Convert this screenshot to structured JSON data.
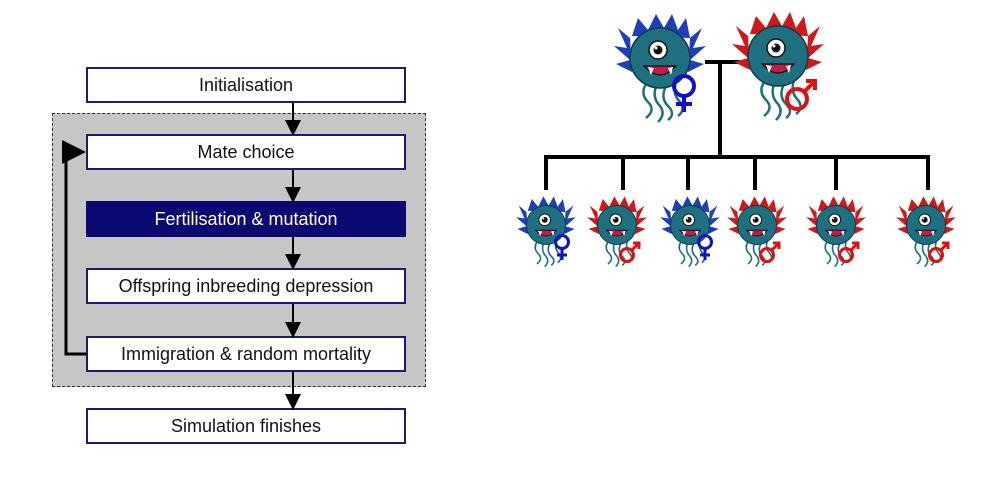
{
  "flowchart": {
    "steps": [
      "Initialisation",
      "Mate choice",
      "Fertilisation & mutation",
      "Offspring inbreeding depression",
      "Immigration & random mortality",
      "Simulation finishes"
    ],
    "highlighted_step": "Fertilisation & mutation"
  },
  "pedigree": {
    "parents": [
      "female",
      "male"
    ],
    "offspring": [
      "female",
      "male",
      "female",
      "male",
      "male",
      "male"
    ]
  },
  "colors": {
    "box_border": "#1a1a7a",
    "highlight": "#0a0a72",
    "loop_panel": "#c6c6c6",
    "female_symbol": "#1010c8",
    "male_symbol": "#e01010",
    "female_hair": "#1f3fb8",
    "male_hair": "#d01818",
    "monster_body": "#1e6f80"
  }
}
